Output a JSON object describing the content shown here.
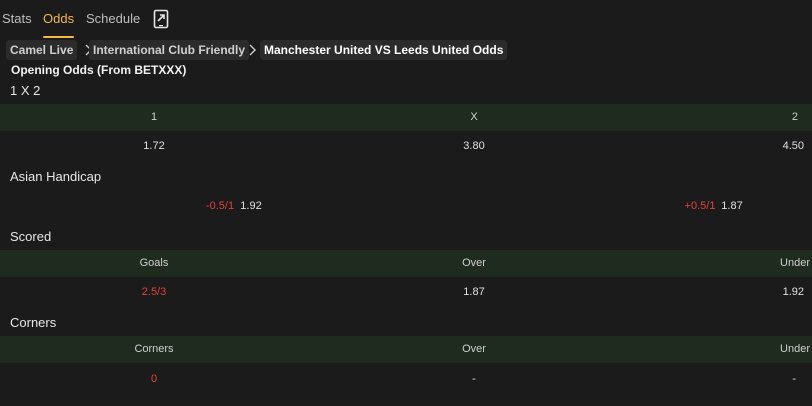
{
  "tabs": [
    {
      "label": "Stats",
      "active": false
    },
    {
      "label": "Odds",
      "active": true
    },
    {
      "label": "Schedule",
      "active": false
    }
  ],
  "share_icon": "share-external-icon",
  "breadcrumb": {
    "items": [
      "Camel Live",
      "International Club Friendly",
      "Manchester United VS Leeds United Odds"
    ],
    "separator_icon": "chevron-right-icon"
  },
  "opening_odds_title": "Opening Odds (From BETXXX)",
  "sections": {
    "one_x_two": {
      "title": "1 X 2",
      "headers": [
        "1",
        "X",
        "2"
      ],
      "values": [
        "1.72",
        "3.80",
        "4.50"
      ]
    },
    "asian_handicap": {
      "title": "Asian Handicap",
      "home_line": "-0.5/1",
      "home_odds": "1.92",
      "away_line": "+0.5/1",
      "away_odds": "1.87"
    },
    "scored": {
      "title": "Scored",
      "headers": [
        "Goals",
        "Over",
        "Under"
      ],
      "values": [
        "2.5/3",
        "1.87",
        "1.92"
      ]
    },
    "corners": {
      "title": "Corners",
      "headers": [
        "Corners",
        "Over",
        "Under"
      ],
      "values": [
        "0",
        "-",
        "-"
      ]
    }
  },
  "colors": {
    "accent": "#f2b84b",
    "background": "#1b1b1b",
    "header_band": "#1f2b1f",
    "negative_red": "#e0413b"
  }
}
